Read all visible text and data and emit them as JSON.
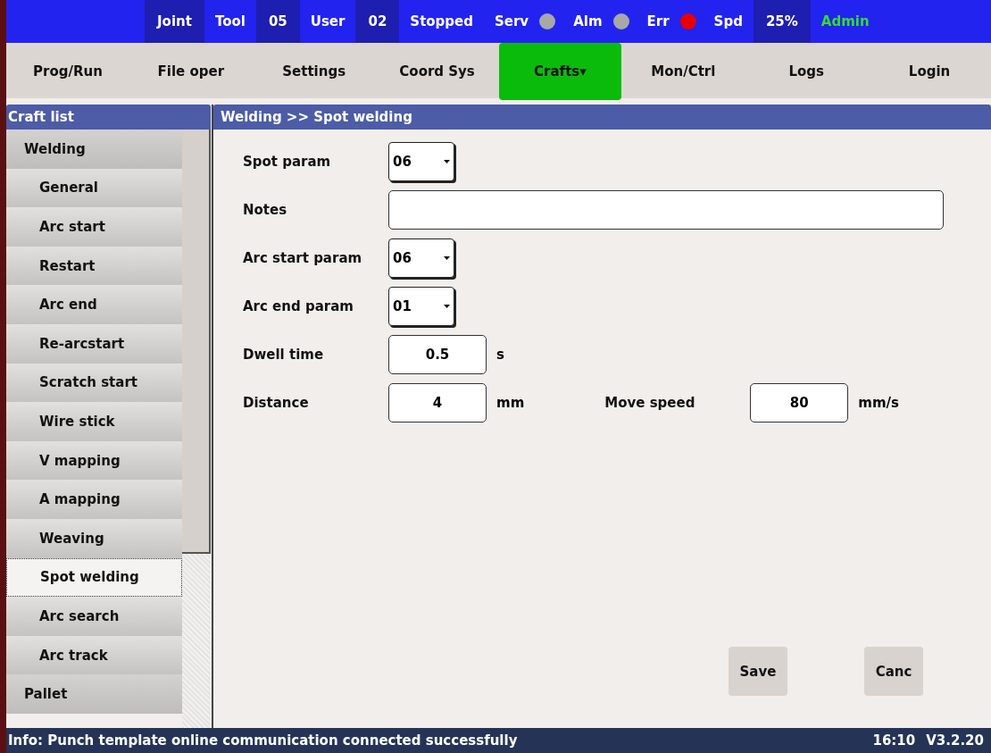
{
  "status_bar": [
    {
      "kind": "value",
      "text": "Joint"
    },
    {
      "kind": "label",
      "text": "Tool"
    },
    {
      "kind": "value",
      "text": "05"
    },
    {
      "kind": "label",
      "text": "User"
    },
    {
      "kind": "value",
      "text": "02"
    },
    {
      "kind": "label",
      "text": "Stopped"
    },
    {
      "kind": "indicator",
      "text": "Serv",
      "color": "#a8a8a8"
    },
    {
      "kind": "indicator",
      "text": "Alm",
      "color": "#a8a8a8"
    },
    {
      "kind": "indicator",
      "text": "Err",
      "color": "#e80000"
    },
    {
      "kind": "label",
      "text": "Spd"
    },
    {
      "kind": "value",
      "text": "25%"
    },
    {
      "kind": "user",
      "text": "Admin"
    }
  ],
  "menu": [
    {
      "label": "Prog/Run",
      "selected": false
    },
    {
      "label": "File oper",
      "selected": false
    },
    {
      "label": "Settings",
      "selected": false
    },
    {
      "label": "Coord Sys",
      "selected": false
    },
    {
      "label": "Crafts▾",
      "selected": true
    },
    {
      "label": "Mon/Ctrl",
      "selected": false
    },
    {
      "label": "Logs",
      "selected": false
    },
    {
      "label": "Login",
      "selected": false
    }
  ],
  "craft_list": {
    "title": "Craft list",
    "items": [
      {
        "label": "Welding",
        "selected": false,
        "children": [
          {
            "label": "General",
            "selected": false
          },
          {
            "label": "Arc start",
            "selected": false
          },
          {
            "label": "Restart",
            "selected": false
          },
          {
            "label": "Arc end",
            "selected": false
          },
          {
            "label": "Re-arcstart",
            "selected": false
          },
          {
            "label": "Scratch start",
            "selected": false
          },
          {
            "label": "Wire stick",
            "selected": false
          },
          {
            "label": "V mapping",
            "selected": false
          },
          {
            "label": "A mapping",
            "selected": false
          },
          {
            "label": "Weaving",
            "selected": false
          },
          {
            "label": "Spot welding",
            "selected": true
          },
          {
            "label": "Arc search",
            "selected": false
          },
          {
            "label": "Arc track",
            "selected": false
          }
        ]
      },
      {
        "label": "Pallet",
        "selected": false
      }
    ]
  },
  "panel": {
    "title": "Welding >> Spot welding",
    "rows": [
      [
        {
          "kind": "dropdown",
          "label": "Spot param",
          "value": "06"
        }
      ],
      [
        {
          "kind": "text",
          "label": "Notes"
        }
      ],
      [
        {
          "kind": "dropdown",
          "label": "Arc start param",
          "value": "06"
        }
      ],
      [
        {
          "kind": "dropdown",
          "label": "Arc end param",
          "value": "01"
        }
      ],
      [
        {
          "kind": "number",
          "label": "Dwell time",
          "value": "0.5",
          "unit": "s"
        }
      ],
      [
        {
          "kind": "number",
          "label": "Distance",
          "value": "4",
          "unit": "mm"
        },
        {
          "kind": "number",
          "label": "Move speed",
          "value": "80",
          "unit": "mm/s"
        }
      ]
    ],
    "buttons": [
      "Save",
      "Canc"
    ]
  },
  "info_bar": {
    "message": "Info: Punch template online communication connected successfully",
    "time": "16:10",
    "version": "V3.2.20"
  }
}
